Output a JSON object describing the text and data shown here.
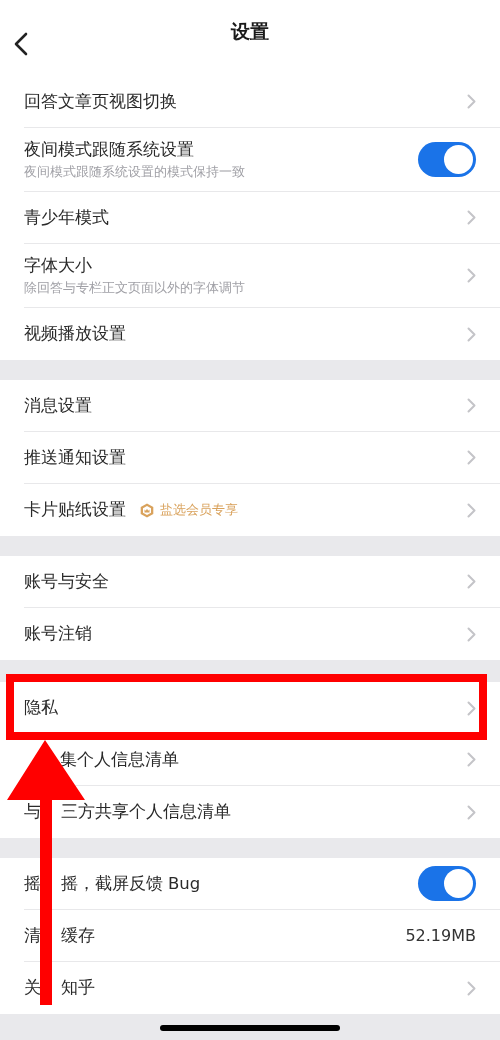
{
  "header": {
    "title": "设置"
  },
  "sections": [
    {
      "rows": [
        {
          "kind": "link",
          "label": "回答文章页视图切换"
        },
        {
          "kind": "toggle",
          "label": "夜间模式跟随系统设置",
          "subtitle": "夜间模式跟随系统设置的模式保持一致",
          "on": true
        },
        {
          "kind": "link",
          "label": "青少年模式"
        },
        {
          "kind": "link",
          "label": "字体大小",
          "subtitle": "除回答与专栏正文页面以外的字体调节"
        },
        {
          "kind": "link",
          "label": "视频播放设置"
        }
      ]
    },
    {
      "rows": [
        {
          "kind": "link",
          "label": "消息设置"
        },
        {
          "kind": "link",
          "label": "推送通知设置"
        },
        {
          "kind": "link",
          "label": "卡片贴纸设置",
          "badge": "盐选会员专享"
        }
      ]
    },
    {
      "rows": [
        {
          "kind": "link",
          "label": "账号与安全"
        },
        {
          "kind": "link",
          "label": "账号注销"
        }
      ]
    },
    {
      "rows": [
        {
          "kind": "link",
          "label": "隐私",
          "highlighted": true
        },
        {
          "kind": "link",
          "label_parts": [
            "集个人信息清单"
          ]
        },
        {
          "kind": "link",
          "label_parts": [
            "与",
            "三方共享个人信息清单"
          ]
        }
      ]
    },
    {
      "rows": [
        {
          "kind": "toggle",
          "label_parts": [
            "摇",
            "摇，截屏反馈 Bug"
          ],
          "on": true
        },
        {
          "kind": "value",
          "label_parts": [
            "清",
            "缓存"
          ],
          "value": "52.19MB"
        },
        {
          "kind": "link",
          "label_parts": [
            "关",
            "知乎"
          ]
        }
      ]
    }
  ]
}
